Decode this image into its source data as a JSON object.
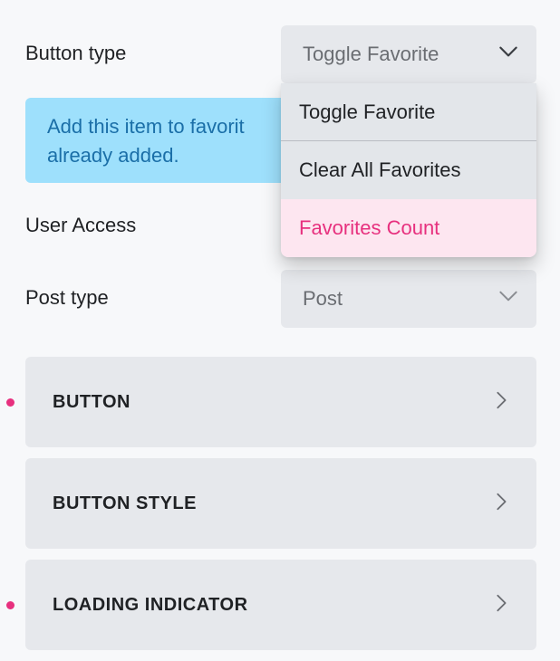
{
  "colors": {
    "accent": "#e7307e",
    "notice_bg": "#9ee0fc",
    "notice_text": "#1b6fa8",
    "control_bg": "#e6e8ec"
  },
  "button_type": {
    "label": "Button type",
    "selected": "Toggle Favorite",
    "icon": "chevron-down-icon",
    "options": [
      "Toggle Favorite",
      "Clear All Favorites",
      "Favorites Count"
    ],
    "highlighted_option": "Favorites Count"
  },
  "notice": {
    "line1": "Add this item to favorit",
    "line2": "already added."
  },
  "user_access": {
    "label": "User Access"
  },
  "post_type": {
    "label": "Post type",
    "selected": "Post",
    "icon": "chevron-down-icon"
  },
  "sections": [
    {
      "title": "BUTTON",
      "modified": true,
      "icon": "chevron-right-icon"
    },
    {
      "title": "BUTTON STYLE",
      "modified": false,
      "icon": "chevron-right-icon"
    },
    {
      "title": "LOADING INDICATOR",
      "modified": true,
      "icon": "chevron-right-icon"
    }
  ]
}
